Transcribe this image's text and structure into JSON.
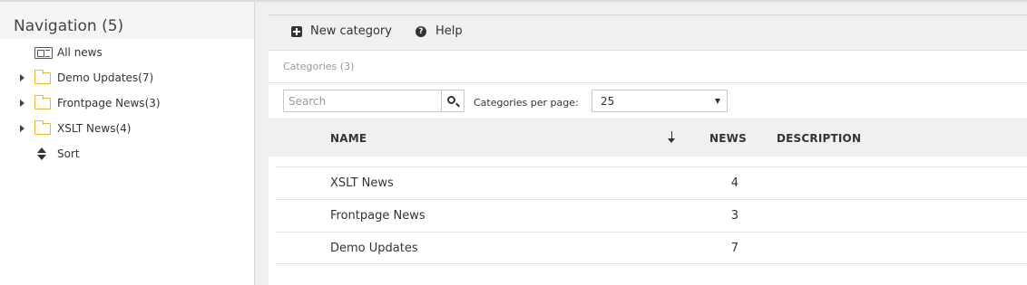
{
  "sidebar": {
    "title": "Navigation (5)",
    "items": [
      {
        "label": "All news",
        "icon": "news-icon",
        "expandable": false
      },
      {
        "label": "Demo Updates(7)",
        "icon": "folder-icon",
        "expandable": true
      },
      {
        "label": "Frontpage News(3)",
        "icon": "folder-icon",
        "expandable": true
      },
      {
        "label": "XSLT News(4)",
        "icon": "folder-icon",
        "expandable": true
      },
      {
        "label": "Sort",
        "icon": "sort-icon",
        "expandable": false
      }
    ]
  },
  "toolbar": {
    "new_category_label": "New category",
    "help_label": "Help"
  },
  "main": {
    "section_title": "Categories (3)",
    "search": {
      "placeholder": "Search",
      "value": ""
    },
    "per_page_label": "Categories per page:",
    "per_page_value": "25"
  },
  "table": {
    "headers": {
      "name": "NAME",
      "news": "NEWS",
      "description": "DESCRIPTION"
    },
    "rows": [
      {
        "name": "XSLT News",
        "news": "4",
        "description": ""
      },
      {
        "name": "Frontpage News",
        "news": "3",
        "description": ""
      },
      {
        "name": "Demo Updates",
        "news": "7",
        "description": ""
      }
    ]
  },
  "colors": {
    "folder": "#f0b429",
    "header_bg": "#f0f0f0"
  }
}
